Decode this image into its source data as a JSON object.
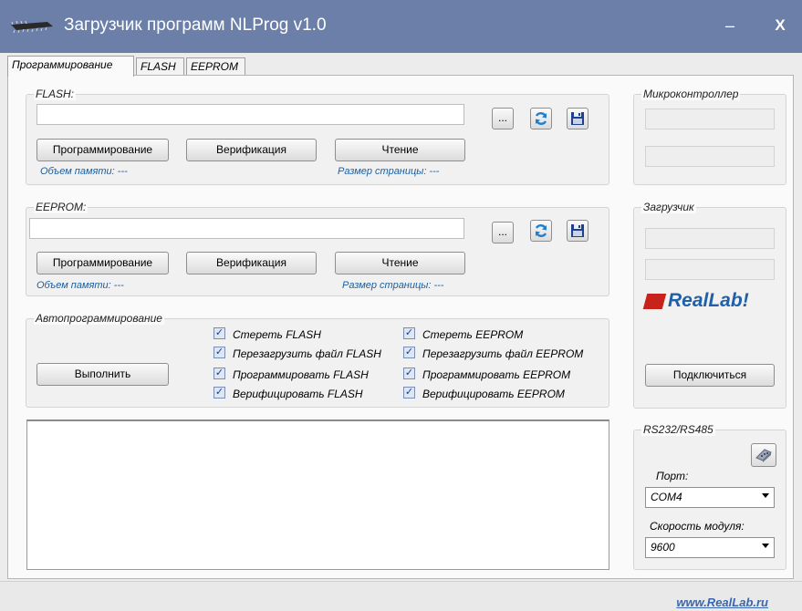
{
  "window": {
    "title": "Загрузчик программ NLProg v1.0",
    "minimize_label": "–",
    "close_label": "X"
  },
  "tabs": [
    {
      "label": "Программирование"
    },
    {
      "label": "FLASH"
    },
    {
      "label": "EEPROM"
    }
  ],
  "flash": {
    "title": "FLASH:",
    "file_path": "",
    "browse_label": "...",
    "program_label": "Программирование",
    "verify_label": "Верификация",
    "read_label": "Чтение",
    "memory_label": "Объем памяти: ---",
    "page_size_label": "Размер страницы: ---"
  },
  "eeprom": {
    "title": "EEPROM:",
    "file_path": "",
    "browse_label": "...",
    "program_label": "Программирование",
    "verify_label": "Верификация",
    "read_label": "Чтение",
    "memory_label": "Объем памяти: ---",
    "page_size_label": "Размер страницы: ---"
  },
  "auto": {
    "title": "Автопрограммирование",
    "run_label": "Выполнить",
    "checkboxes": [
      {
        "label": "Стереть FLASH",
        "checked": true
      },
      {
        "label": "Перезагрузить файл FLASH",
        "checked": true
      },
      {
        "label": "Программировать FLASH",
        "checked": true
      },
      {
        "label": "Верифицировать FLASH",
        "checked": true
      },
      {
        "label": "Стереть EEPROM",
        "checked": true
      },
      {
        "label": "Перезагрузить файл  EEPROM",
        "checked": true
      },
      {
        "label": "Программировать  EEPROM",
        "checked": true
      },
      {
        "label": "Верифицировать  EEPROM",
        "checked": true
      }
    ]
  },
  "log": {
    "text": ""
  },
  "mcu": {
    "title": "Микроконтроллер",
    "field1": "",
    "field2": ""
  },
  "bootloader": {
    "title": "Загрузчик",
    "field1": "",
    "field2": "",
    "logo_text": "RealLab!",
    "connect_label": "Подключиться"
  },
  "serial": {
    "title": "RS232/RS485",
    "port_label": "Порт:",
    "port_value": "COM4",
    "speed_label": "Скорость модуля:",
    "speed_value": "9600"
  },
  "footer": {
    "link": "www.RealLab.ru"
  },
  "colors": {
    "titlebar": "#6b7fa8",
    "info_text": "#1a5fa0",
    "logo_red": "#c8231b",
    "logo_blue": "#1f60a8"
  }
}
